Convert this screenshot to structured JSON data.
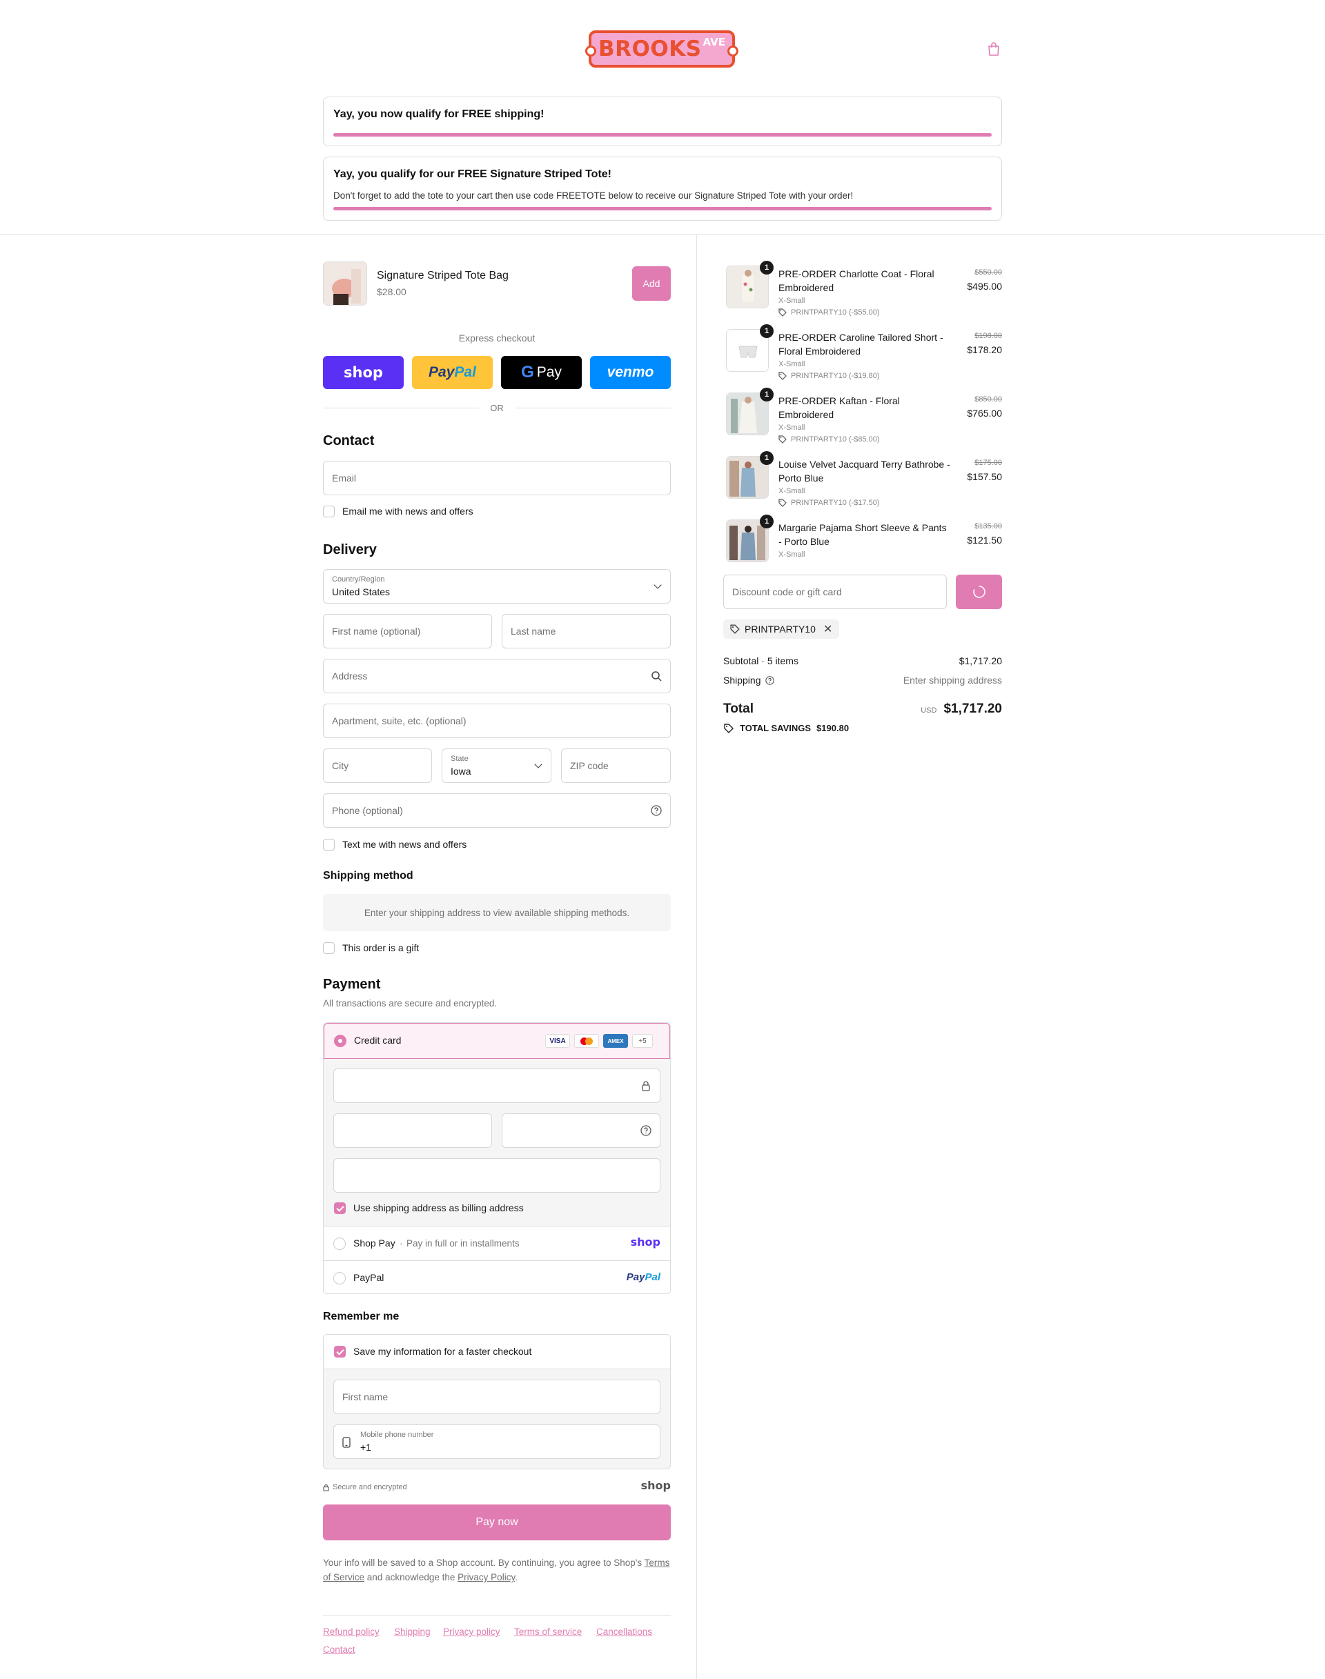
{
  "header": {
    "logo_text": "BROOKS",
    "logo_sup": "AVE",
    "banner1_title": "Yay, you now qualify for FREE shipping!",
    "banner2_title": "Yay, you qualify for our FREE Signature Striped Tote!",
    "banner2_sub": "Don't forget to add the tote to your cart then use code FREETOTE below to receive our Signature Striped Tote with your order!",
    "shipping_progress": 1.0,
    "tote_progress": 1.0
  },
  "upsell": {
    "name": "Signature Striped Tote Bag",
    "price": "$28.00",
    "add_label": "Add"
  },
  "express": {
    "label": "Express checkout",
    "shop": "shop",
    "paypal_a": "Pay",
    "paypal_b": "Pal",
    "gpay": "Pay",
    "venmo": "venmo",
    "or": "OR"
  },
  "contact": {
    "title": "Contact",
    "email_placeholder": "Email",
    "news_label": "Email me with news and offers"
  },
  "delivery": {
    "title": "Delivery",
    "country_label": "Country/Region",
    "country_value": "United States",
    "first_name_placeholder": "First name (optional)",
    "last_name_placeholder": "Last name",
    "address_placeholder": "Address",
    "apartment_placeholder": "Apartment, suite, etc. (optional)",
    "city_placeholder": "City",
    "state_label": "State",
    "state_value": "Iowa",
    "zip_placeholder": "ZIP code",
    "phone_placeholder": "Phone (optional)",
    "text_label": "Text me with news and offers"
  },
  "shipping_method": {
    "title": "Shipping method",
    "notice": "Enter your shipping address to view available shipping methods.",
    "gift_label": "This order is a gift"
  },
  "payment": {
    "title": "Payment",
    "subtitle": "All transactions are secure and encrypted.",
    "credit_card_label": "Credit card",
    "cards": [
      "VISA",
      "MC",
      "AMEX",
      "+5"
    ],
    "billing_label": "Use shipping address as billing address",
    "shop_pay_label": "Shop Pay",
    "shop_pay_sub": "Pay in full or in installments",
    "shop_logo": "shop",
    "paypal_label": "PayPal",
    "paypal_logo_a": "Pay",
    "paypal_logo_b": "Pal"
  },
  "remember": {
    "title": "Remember me",
    "save_label": "Save my information for a faster checkout",
    "first_name_placeholder": "First name",
    "mobile_label": "Mobile phone number",
    "mobile_value": "+1",
    "secure_label": "Secure and encrypted",
    "shop_logo": "shop"
  },
  "pay": {
    "button": "Pay now",
    "legal_1": "Your info will be saved to a Shop account. By continuing, you agree to Shop's",
    "tos": "Terms of Service",
    "legal_2": "and acknowledge the",
    "privacy": "Privacy Policy",
    "legal_3": "."
  },
  "footer_links": [
    "Refund policy",
    "Shipping",
    "Privacy policy",
    "Terms of service",
    "Cancellations",
    "Contact"
  ],
  "order": {
    "items": [
      {
        "qty": "1",
        "name": "PRE-ORDER Charlotte Coat - Floral Embroidered",
        "variant": "X-Small",
        "discount": "PRINTPARTY10 (-$55.00)",
        "old_price": "$550.00",
        "price": "$495.00",
        "thumb_color": "#e8e4de"
      },
      {
        "qty": "1",
        "name": "PRE-ORDER Caroline Tailored Short - Floral Embroidered",
        "variant": "X-Small",
        "discount": "PRINTPARTY10 (-$19.80)",
        "old_price": "$198.00",
        "price": "$178.20",
        "thumb_color": "#f2f2f2"
      },
      {
        "qty": "1",
        "name": "PRE-ORDER Kaftan - Floral Embroidered",
        "variant": "X-Small",
        "discount": "PRINTPARTY10 (-$85.00)",
        "old_price": "$850.00",
        "price": "$765.00",
        "thumb_color": "#dfe3e4"
      },
      {
        "qty": "1",
        "name": "Louise Velvet Jacquard Terry Bathrobe - Porto Blue",
        "variant": "X-Small",
        "discount": "PRINTPARTY10 (-$17.50)",
        "old_price": "$175.00",
        "price": "$157.50",
        "thumb_color": "#d7dde2"
      },
      {
        "qty": "1",
        "name": "Margarie Pajama Short Sleeve & Pants - Porto Blue",
        "variant": "X-Small",
        "discount": "",
        "old_price": "$135.00",
        "price": "$121.50",
        "thumb_color": "#cfd6de"
      }
    ],
    "discount_placeholder": "Discount code or gift card",
    "applied_code": "PRINTPARTY10",
    "subtotal_label": "Subtotal · 5 items",
    "subtotal_value": "$1,717.20",
    "shipping_label": "Shipping",
    "shipping_value": "Enter shipping address",
    "total_label": "Total",
    "currency": "USD",
    "total_value": "$1,717.20",
    "savings_label": "TOTAL SAVINGS",
    "savings_value": "$190.80"
  },
  "colors": {
    "accent": "#e07cb2",
    "shop_purple": "#5a31f4",
    "paypal_yellow": "#ffc439",
    "venmo_blue": "#008cff",
    "logo_red": "#e8502f",
    "logo_pink": "#f5a8cf"
  }
}
